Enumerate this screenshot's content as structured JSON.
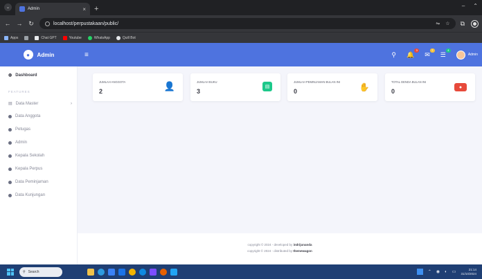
{
  "browser": {
    "tab_title": "Admin",
    "tab_close": "×",
    "new_tab": "+",
    "url": "localhost/perpustakaan/public/",
    "window_controls": [
      "–",
      "⌃"
    ],
    "bookmarks": [
      {
        "label": "Apps",
        "icon": "apps-icon",
        "color": "#8ab4f8"
      },
      {
        "label": "",
        "icon": "grid-icon",
        "color": "#9aa0a6"
      },
      {
        "label": "Chat GPT",
        "icon": "chatgpt-icon",
        "color": "#e8eaed"
      },
      {
        "label": "Youtube",
        "icon": "youtube-icon",
        "color": "#ff0000"
      },
      {
        "label": "WhatsApp",
        "icon": "whatsapp-icon",
        "color": "#25d366"
      },
      {
        "label": "Quill Bot",
        "icon": "quillbot-icon",
        "color": "#e8eaed"
      }
    ]
  },
  "app": {
    "brand": "Admin",
    "user_name": "Admin",
    "colors": {
      "primary": "#4e73df",
      "success": "#1cc88a",
      "info": "#36b9cc",
      "warning": "#f6c23e",
      "danger": "#e74a3b"
    },
    "notifications": [
      {
        "icon": "search-icon",
        "badge": ""
      },
      {
        "icon": "bell-icon",
        "badge": "3",
        "badge_color": "#e74a3b"
      },
      {
        "icon": "envelope-icon",
        "badge": "7",
        "badge_color": "#f6c23e"
      },
      {
        "icon": "list-icon",
        "badge": "4",
        "badge_color": "#1cc88a"
      }
    ]
  },
  "sidebar": {
    "dashboard": "Dashboard",
    "heading": "FEATURES",
    "items": [
      "Data Master",
      "Data Anggota",
      "Petugas",
      "Admin",
      "Kepala Sekolah",
      "Kepala Perpus",
      "Data Peminjaman",
      "Data Kunjungan"
    ]
  },
  "cards": [
    {
      "label": "JUMLAH ANGGOTA",
      "value": "2",
      "icon": "user-icon",
      "color": "#4e73df"
    },
    {
      "label": "JUMLAH BUKU",
      "value": "3",
      "icon": "book-icon",
      "color": "#1cc88a"
    },
    {
      "label": "JUMLAH PEMINJAMAN BULAN INI",
      "value": "0",
      "icon": "hand-holding-icon",
      "color": "#f6a23e"
    },
    {
      "label": "TOTAL DENDA BULAN INI",
      "value": "0",
      "icon": "money-icon",
      "color": "#e74a3b"
    }
  ],
  "footer": {
    "line1_prefix": "copyright © 2024 - developed by",
    "line1_author": "indrijunanda",
    "line2_prefix": "copyright © 2024 - distributed by",
    "line2_author": "themewagon"
  },
  "taskbar": {
    "search_placeholder": "Search",
    "time": "21:14",
    "date": "31/10/2024"
  }
}
